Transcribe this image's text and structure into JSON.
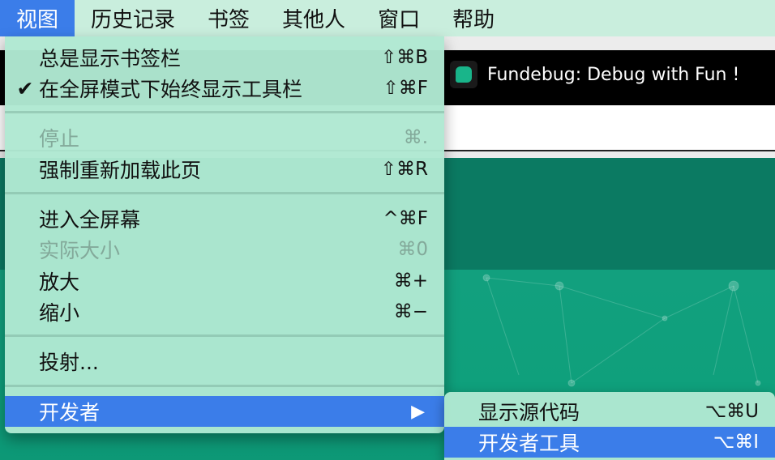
{
  "menubar": {
    "items": [
      {
        "label": "视图",
        "active": true
      },
      {
        "label": "历史记录",
        "active": false
      },
      {
        "label": "书签",
        "active": false
      },
      {
        "label": "其他人",
        "active": false
      },
      {
        "label": "窗口",
        "active": false
      },
      {
        "label": "帮助",
        "active": false
      }
    ]
  },
  "view_menu": {
    "items": [
      {
        "label": "总是显示书签栏",
        "shortcut": "⇧⌘B",
        "checked": "",
        "disabled": false
      },
      {
        "label": "在全屏模式下始终显示工具栏",
        "shortcut": "⇧⌘F",
        "checked": "✔",
        "disabled": false
      },
      {
        "label": "停止",
        "shortcut": "⌘.",
        "checked": "",
        "disabled": true
      },
      {
        "label": "强制重新加载此页",
        "shortcut": "⇧⌘R",
        "checked": "",
        "disabled": false
      },
      {
        "label": "进入全屏幕",
        "shortcut": "^⌘F",
        "checked": "",
        "disabled": false
      },
      {
        "label": "实际大小",
        "shortcut": "⌘0",
        "checked": "",
        "disabled": true
      },
      {
        "label": "放大",
        "shortcut": "⌘+",
        "checked": "",
        "disabled": false
      },
      {
        "label": "缩小",
        "shortcut": "⌘−",
        "checked": "",
        "disabled": false
      },
      {
        "label": "投射...",
        "shortcut": "",
        "checked": "",
        "disabled": false
      },
      {
        "label": "开发者",
        "shortcut": "▶",
        "checked": "",
        "disabled": false,
        "highlighted": true
      }
    ]
  },
  "developer_submenu": {
    "items": [
      {
        "label": "显示源代码",
        "shortcut": "⌥⌘U"
      },
      {
        "label": "开发者工具",
        "shortcut": "⌥⌘I",
        "highlighted": true
      }
    ]
  },
  "browser_tab": {
    "title": "Fundebug: Debug with Fun !",
    "icon": "fundebug-logo-icon"
  },
  "colors": {
    "menubar_bg": "#c9eedd",
    "menu_bg": "#afe8d2",
    "highlight": "#3b7de9",
    "page_teal": "#0fa07c"
  }
}
